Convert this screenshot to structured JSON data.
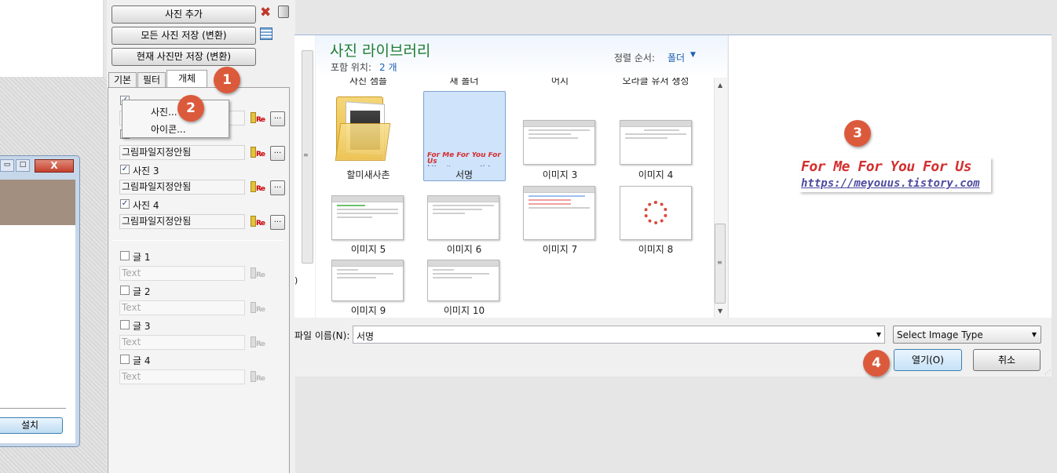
{
  "left_panel": {
    "buttons": {
      "add_photo": "사진 추가",
      "save_all": "모든 사진 저장 (변환)",
      "save_current": "현재 사진만 저장 (변환)"
    },
    "tabs": [
      "기본",
      "필터",
      "개체"
    ],
    "context_menu": [
      "사진...",
      "아이콘..."
    ],
    "rows": [
      {
        "label": "사진 3",
        "checked": true,
        "field": "그림파일지정안됨"
      },
      {
        "label": "사진 4",
        "checked": true,
        "field": "그림파일지정안됨"
      }
    ],
    "hidden_row_field": "그림파일지정안됨",
    "text_rows": [
      {
        "label": "글 1",
        "placeholder": "Text"
      },
      {
        "label": "글 2",
        "placeholder": "Text"
      },
      {
        "label": "글 3",
        "placeholder": "Text"
      },
      {
        "label": "글 4",
        "placeholder": "Text"
      }
    ],
    "install_button": "설치"
  },
  "dialog": {
    "library_title": "사진 라이브러리",
    "includes_label": "포함 위치:",
    "includes_value": "2 개",
    "sort_label": "정렬 순서:",
    "sort_value": "폴더",
    "top_labels": [
      "사진 샘플",
      "새 폴더",
      "어지",
      "오라클 유저 생성"
    ],
    "items": [
      {
        "name": "할미새사촌",
        "type": "folder"
      },
      {
        "name": "서명",
        "type": "signature",
        "selected": true
      },
      {
        "name": "이미지 3"
      },
      {
        "name": "이미지 4"
      },
      {
        "name": "이미지 5"
      },
      {
        "name": "이미지 6"
      },
      {
        "name": "이미지 7"
      },
      {
        "name": "이미지 8"
      },
      {
        "name": "이미지 9"
      },
      {
        "name": "이미지 10"
      }
    ],
    "preview": {
      "line1": "For Me For You For Us",
      "line2": "https://meyouus.tistory.com"
    },
    "filename_label": "파일 이름(N):",
    "filename_value": "서명",
    "file_type": "Select Image Type",
    "open_button": "열기(O)",
    "cancel_button": "취소"
  },
  "badges": [
    "1",
    "2",
    "3",
    "4"
  ],
  "colors": {
    "badge": "#dc5a3c",
    "title_green": "#1e7d32",
    "link_blue": "#1a5fb4",
    "selected_bg": "#cfe3fb"
  }
}
